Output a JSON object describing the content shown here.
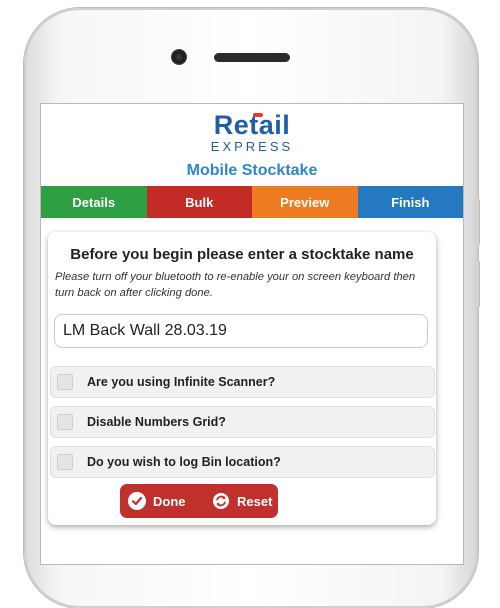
{
  "brand": {
    "name": "Retail",
    "sub": "EXPRESS"
  },
  "app": {
    "title": "Mobile Stocktake"
  },
  "tabs": [
    {
      "label": "Details",
      "color": "#2ea043"
    },
    {
      "label": "Bulk",
      "color": "#c22b26"
    },
    {
      "label": "Preview",
      "color": "#ee7a22"
    },
    {
      "label": "Finish",
      "color": "#2479c1"
    }
  ],
  "form": {
    "heading": "Before you begin please enter a stocktake name",
    "note": "Please turn off your bluetooth to re-enable your on screen keyboard then turn back on after clicking done.",
    "stocktake_name": "LM Back Wall 28.03.19",
    "options": [
      {
        "label": "Are you using Infinite Scanner?",
        "checked": false
      },
      {
        "label": "Disable Numbers Grid?",
        "checked": false
      },
      {
        "label": "Do you wish to log Bin location?",
        "checked": false
      }
    ],
    "done_label": "Done",
    "reset_label": "Reset"
  },
  "icons": {
    "done": "check-circle-icon",
    "reset": "refresh-icon"
  },
  "colors": {
    "brand_blue": "#1f5fa8",
    "title_blue": "#2f86c8",
    "button_red": "#c0302c"
  }
}
